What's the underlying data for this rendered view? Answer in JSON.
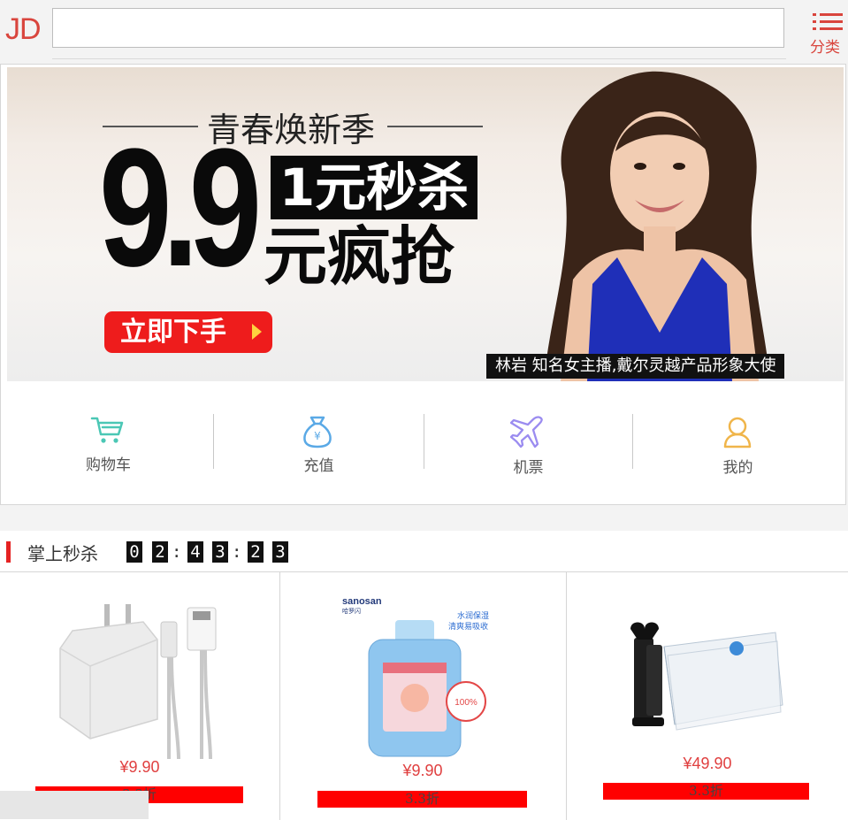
{
  "header": {
    "logo": "JD",
    "search_placeholder": "",
    "menu_label": "分类"
  },
  "banner": {
    "slogan": "青春焕新季",
    "big_price": "9.9",
    "box_text": "1元秒杀",
    "sub_text": "元疯抢",
    "cta_label": "立即下手",
    "caption": "林岩  知名女主播,戴尔灵越产品形象大使"
  },
  "quick_nav": [
    {
      "label": "购物车",
      "icon": "cart-icon",
      "color": "#4bc7b5"
    },
    {
      "label": "充值",
      "icon": "money-bag-icon",
      "color": "#5aa9e6"
    },
    {
      "label": "机票",
      "icon": "airplane-icon",
      "color": "#9b8cf0"
    },
    {
      "label": "我的",
      "icon": "user-icon",
      "color": "#f0b54a"
    }
  ],
  "flash_sale": {
    "title": "掌上秒杀",
    "timer": [
      "0",
      "2",
      "4",
      "3",
      "2",
      "3"
    ]
  },
  "products": [
    {
      "name": "charger-with-cable",
      "price": "¥9.90",
      "discount": "3.3折"
    },
    {
      "name": "sanosan-baby-lotion",
      "price": "¥9.90",
      "discount": "3.3折"
    },
    {
      "name": "vacuum-storage-bags",
      "price": "¥49.90",
      "discount": "3.3折"
    }
  ],
  "colors": {
    "brand_red": "#d9453d",
    "sale_red": "#ff0000"
  }
}
